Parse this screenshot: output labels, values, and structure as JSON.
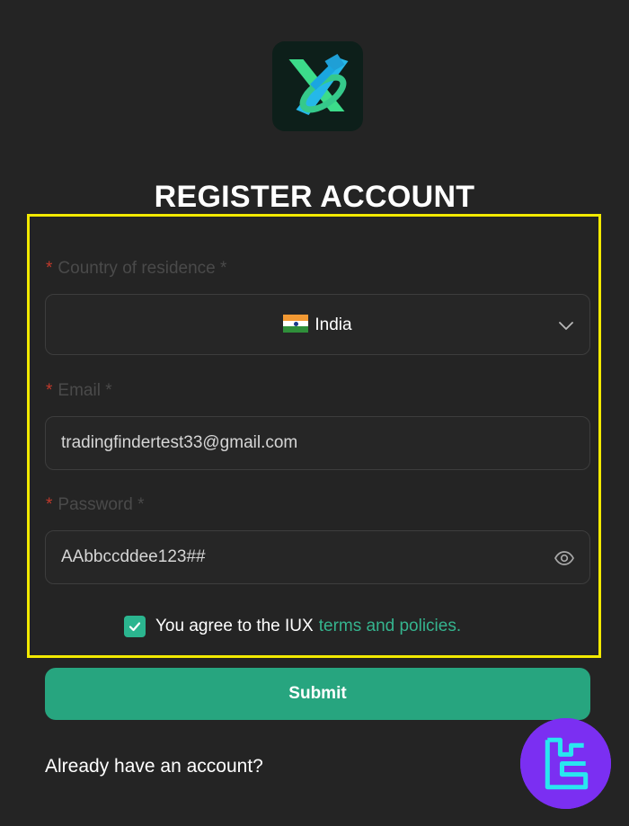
{
  "page": {
    "title": "REGISTER ACCOUNT"
  },
  "form": {
    "country": {
      "label": "Country of residence *",
      "required_mark": "*",
      "value": "India",
      "flag_icon": "india-flag-icon"
    },
    "email": {
      "label": "Email *",
      "required_mark": "*",
      "value": "tradingfindertest33@gmail.com"
    },
    "password": {
      "label": "Password *",
      "required_mark": "*",
      "value": "AAbbccddee123##"
    },
    "agreement": {
      "checked": true,
      "text": "You agree to the IUX",
      "link": "terms and policies."
    },
    "submit_label": "Submit"
  },
  "footer": {
    "already_text": "Already have an account?"
  },
  "colors": {
    "background": "#242424",
    "accent": "#27a57f",
    "link": "#35b48e",
    "highlight": "#f2e900",
    "badge": "#7b2ff2"
  },
  "icons": [
    "app-logo-icon",
    "chevron-down-icon",
    "eye-icon",
    "check-icon",
    "watermark-logo-icon"
  ]
}
